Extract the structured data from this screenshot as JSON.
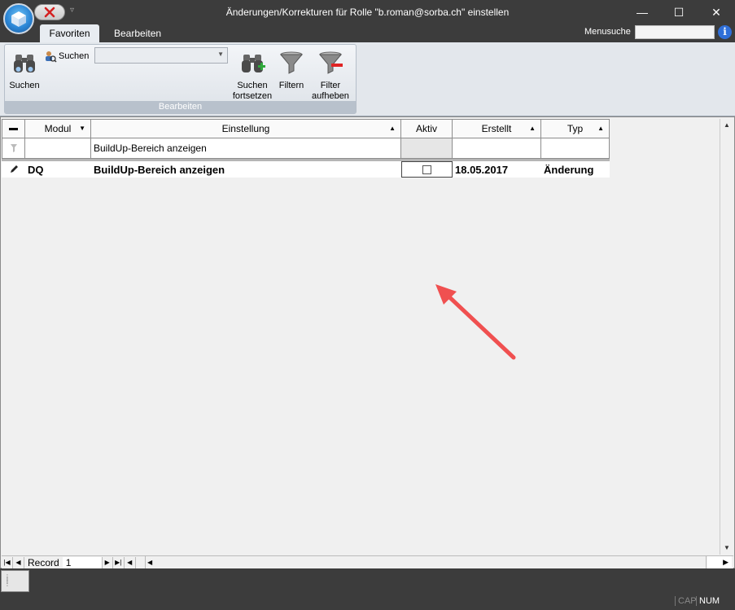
{
  "window": {
    "title": "Änderungen/Korrekturen für Rolle \"b.roman@sorba.ch\" einstellen",
    "minimize": "—",
    "maximize": "☐",
    "close": "✕"
  },
  "tabs": [
    {
      "label": "Favoriten",
      "active": true
    },
    {
      "label": "Bearbeiten",
      "active": false
    }
  ],
  "menusuche": {
    "label": "Menusuche",
    "value": ""
  },
  "ribbon": {
    "group_caption": "Bearbeiten",
    "suchen_label": "Suchen",
    "small_suchen_label": "Suchen",
    "combo_value": "",
    "suchen_fortsetzen_label_1": "Suchen",
    "suchen_fortsetzen_label_2": "fortsetzen",
    "filtern_label": "Filtern",
    "filter_aufheben_label_1": "Filter",
    "filter_aufheben_label_2": "aufheben"
  },
  "grid": {
    "columns": [
      "Modul",
      "Einstellung",
      "Aktiv",
      "Erstellt",
      "Typ"
    ],
    "filter_row": {
      "modul": "",
      "einstellung": "BuildUp-Bereich anzeigen",
      "erstellt": "",
      "typ": ""
    },
    "rows": [
      {
        "modul": "DQ",
        "einstellung": "BuildUp-Bereich anzeigen",
        "aktiv": false,
        "erstellt": "18.05.2017",
        "typ": "Änderung"
      }
    ]
  },
  "navigation": {
    "record_label": "Record",
    "record_value": "1"
  },
  "status": {
    "cap": "CAP",
    "num": "NUM"
  },
  "colors": {
    "annotation_arrow": "#f05050",
    "accent_blue": "#2b86d6"
  }
}
